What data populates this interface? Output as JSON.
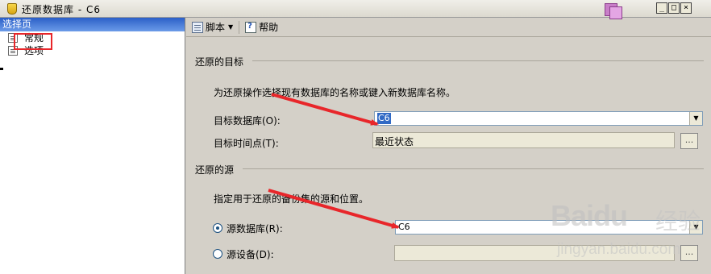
{
  "window": {
    "title": "还原数据库 - C6",
    "controls": [
      "_",
      "□",
      "×"
    ]
  },
  "left_pane": {
    "header": "选择页",
    "items": [
      {
        "label": "常规",
        "icon": "page-icon",
        "selected": true
      },
      {
        "label": "选项",
        "icon": "page-icon",
        "selected": false
      }
    ]
  },
  "toolbar": {
    "script_label": "脚本",
    "help_label": "帮助"
  },
  "target": {
    "heading": "还原的目标",
    "description": "为还原操作选择现有数据库的名称或键入新数据库名称。",
    "db_label": "目标数据库(O):",
    "db_value": "C6",
    "time_label": "目标时间点(T):",
    "time_value": "最近状态",
    "time_button": "..."
  },
  "source": {
    "heading": "还原的源",
    "description": "指定用于还原的备份集的源和位置。",
    "src_db_label": "源数据库(R):",
    "src_db_value": "C6",
    "src_device_label": "源设备(D):",
    "device_button": "..."
  },
  "watermark": {
    "brand": "Baidu",
    "brand2": "经验",
    "url": "jingyan.baidu.com"
  },
  "colors": {
    "annotation": "#e8262a",
    "selection": "#316ac5",
    "header_blue": "#2a5fc8"
  }
}
